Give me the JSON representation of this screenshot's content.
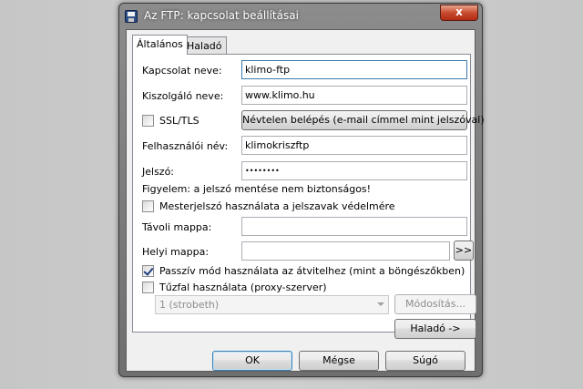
{
  "window": {
    "title": "Az FTP: kapcsolat beállításai",
    "close_glyph": "x"
  },
  "tabs": [
    {
      "label": "Általános",
      "active": true
    },
    {
      "label": "Haladó",
      "active": false
    }
  ],
  "form": {
    "connection_name_label": "Kapcsolat neve:",
    "connection_name_value": "klimo-ftp",
    "server_name_label": "Kiszolgáló neve:",
    "server_name_value": "www.klimo.hu",
    "ssl_label": "SSL/TLS",
    "ssl_checked": false,
    "anonymous_button": "Névtelen belépés (e-mail címmel mint jelszóval)",
    "username_label": "Felhasználói név:",
    "username_value": "klimokriszftp",
    "password_label": "Jelszó:",
    "password_value": "••••••••",
    "password_warning": "Figyelem: a jelszó mentése nem biztonságos!",
    "master_password_label": "Mesterjelszó használata a jelszavak védelmére",
    "master_password_checked": false,
    "remote_folder_label": "Távoli mappa:",
    "remote_folder_value": "",
    "local_folder_label": "Helyi mappa:",
    "local_folder_value": "",
    "browse_button": ">>",
    "passive_mode_label": "Passzív mód használata az átvitelhez (mint a böngészőkben)",
    "passive_mode_checked": true,
    "firewall_label": "Tűzfal használata (proxy-szerver)",
    "firewall_checked": false,
    "firewall_select_value": "1 (strobeth)",
    "modify_button": "Módosítás...",
    "advanced_button": "Haladó ->"
  },
  "footer": {
    "ok": "OK",
    "cancel": "Mégse",
    "help": "Súgó"
  },
  "colors": {
    "accent_focus": "#3d7bad",
    "close_red": "#c84b2f",
    "check_blue": "#1c3f80"
  }
}
